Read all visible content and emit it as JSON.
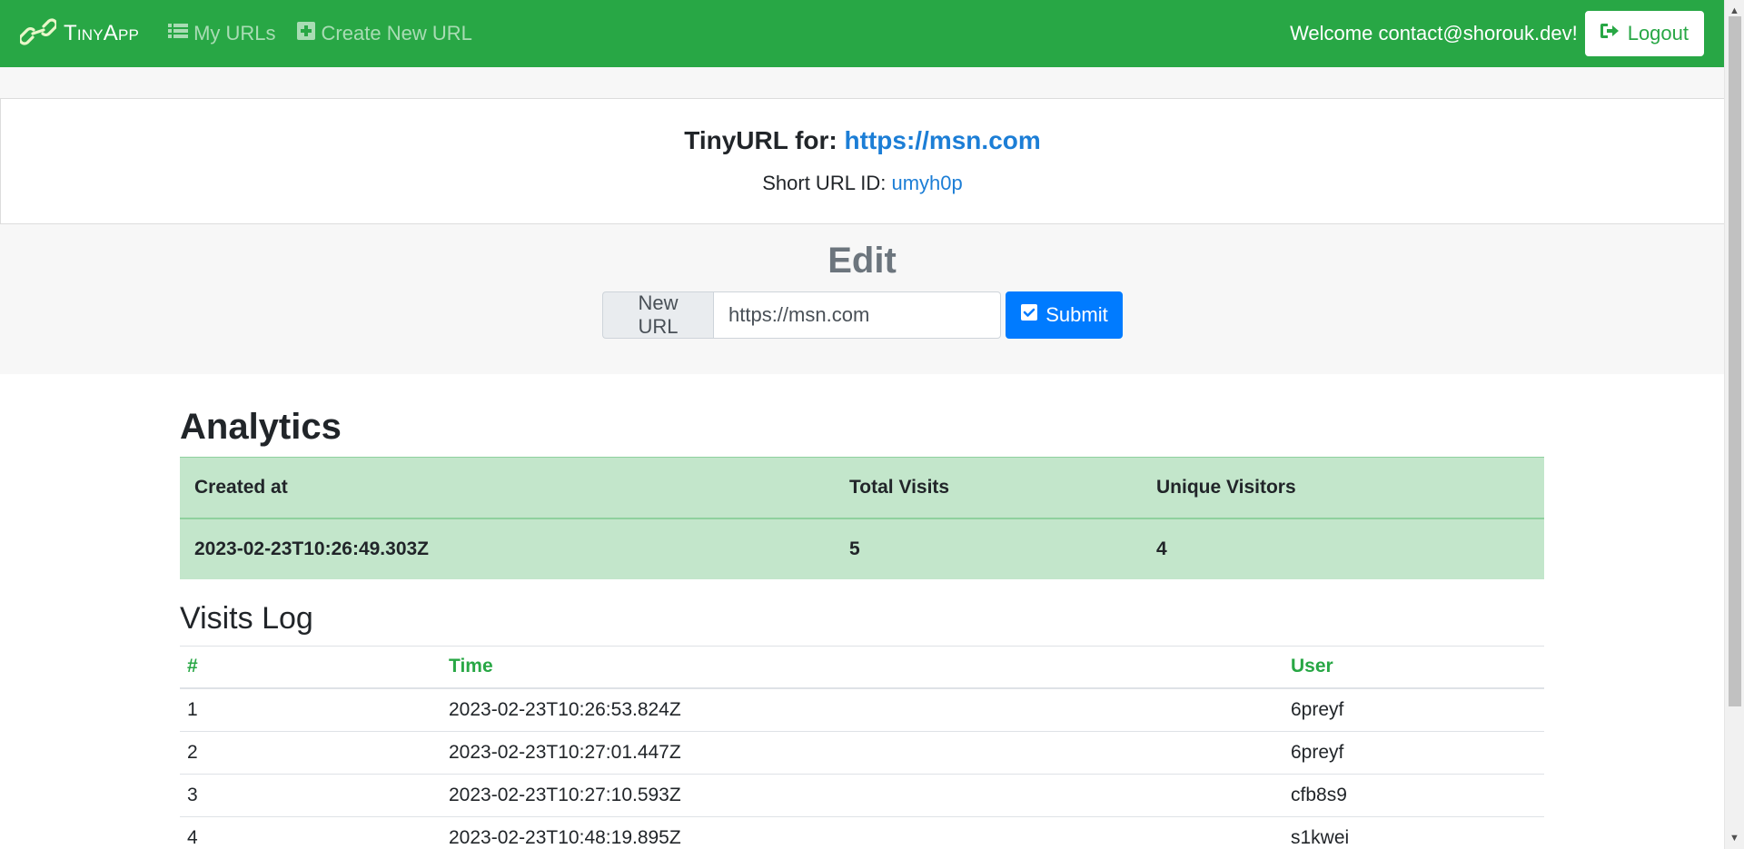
{
  "navbar": {
    "brand": "TinyApp",
    "brand_icon": "chain-link-icon",
    "links": [
      {
        "label": "My URLs",
        "icon": "list-icon"
      },
      {
        "label": "Create New URL",
        "icon": "plus-square-icon"
      }
    ],
    "welcome": "Welcome contact@shorouk.dev!",
    "logout_label": "Logout",
    "logout_icon": "sign-out-icon",
    "color": "#28a745"
  },
  "url_info": {
    "title_prefix": "TinyURL for:",
    "long_url": "https://msn.com",
    "short_id_label": "Short URL ID:",
    "short_id": "umyh0p"
  },
  "edit": {
    "title": "Edit",
    "input_label": "New URL",
    "input_value": "https://msn.com",
    "submit_label": "Submit",
    "submit_icon": "check-square-icon",
    "submit_color": "#007bff"
  },
  "analytics": {
    "title": "Analytics",
    "headers": [
      "Created at",
      "Total Visits",
      "Unique Visitors"
    ],
    "row": [
      "2023-02-23T10:26:49.303Z",
      "5",
      "4"
    ],
    "background": "#c3e6cb"
  },
  "visits_log": {
    "title": "Visits Log",
    "headers": [
      "#",
      "Time",
      "User"
    ],
    "rows": [
      [
        "1",
        "2023-02-23T10:26:53.824Z",
        "6preyf"
      ],
      [
        "2",
        "2023-02-23T10:27:01.447Z",
        "6preyf"
      ],
      [
        "3",
        "2023-02-23T10:27:10.593Z",
        "cfb8s9"
      ],
      [
        "4",
        "2023-02-23T10:48:19.895Z",
        "s1kwei"
      ]
    ]
  }
}
